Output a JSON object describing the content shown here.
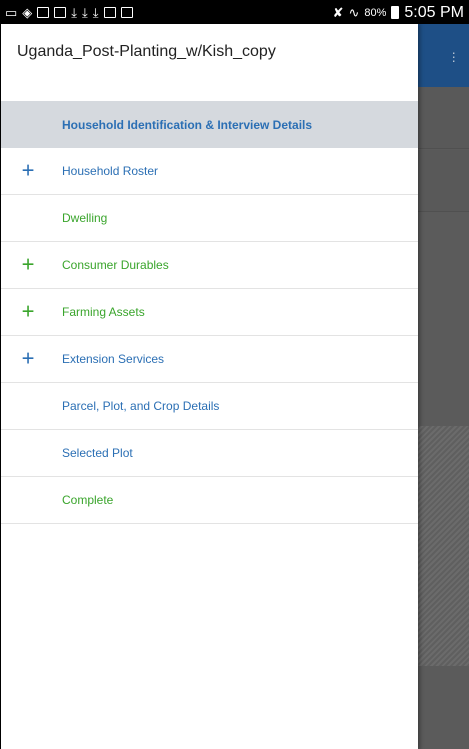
{
  "status_bar": {
    "battery_percent": "80%",
    "time": "5:05 PM",
    "left_icons": [
      "cast-icon",
      "wifi-hotspot-icon",
      "image-icon",
      "mail-icon",
      "download-icon",
      "download-icon",
      "download-icon",
      "briefcase-icon",
      "briefcase-icon"
    ],
    "right_icons": [
      "mute-icon",
      "wifi-icon",
      "battery-icon"
    ]
  },
  "drawer": {
    "title": "Uganda_Post-Planting_w/Kish_copy",
    "items": [
      {
        "label": "Household Identification & Interview Details",
        "color": "blue",
        "expandable": false,
        "selected": true
      },
      {
        "label": "Household Roster",
        "color": "blue",
        "expandable": true,
        "selected": false,
        "expand_symbol": "+"
      },
      {
        "label": "Dwelling",
        "color": "green",
        "expandable": false,
        "selected": false
      },
      {
        "label": "Consumer Durables",
        "color": "green",
        "expandable": true,
        "selected": false,
        "expand_symbol": "+"
      },
      {
        "label": "Farming Assets",
        "color": "green",
        "expandable": true,
        "selected": false,
        "expand_symbol": "+"
      },
      {
        "label": "Extension Services",
        "color": "blue",
        "expandable": true,
        "selected": false,
        "expand_symbol": "+"
      },
      {
        "label": "Parcel, Plot, and Crop Details",
        "color": "blue",
        "expandable": false,
        "selected": false
      },
      {
        "label": "Selected Plot",
        "color": "blue",
        "expandable": false,
        "selected": false
      },
      {
        "label": "Complete",
        "color": "green",
        "expandable": false,
        "selected": false
      }
    ]
  },
  "colors": {
    "blue": "#2b6fb4",
    "green": "#3aa52c",
    "selected_bg": "#d5d9de",
    "toolbar": "#1e4f86"
  }
}
